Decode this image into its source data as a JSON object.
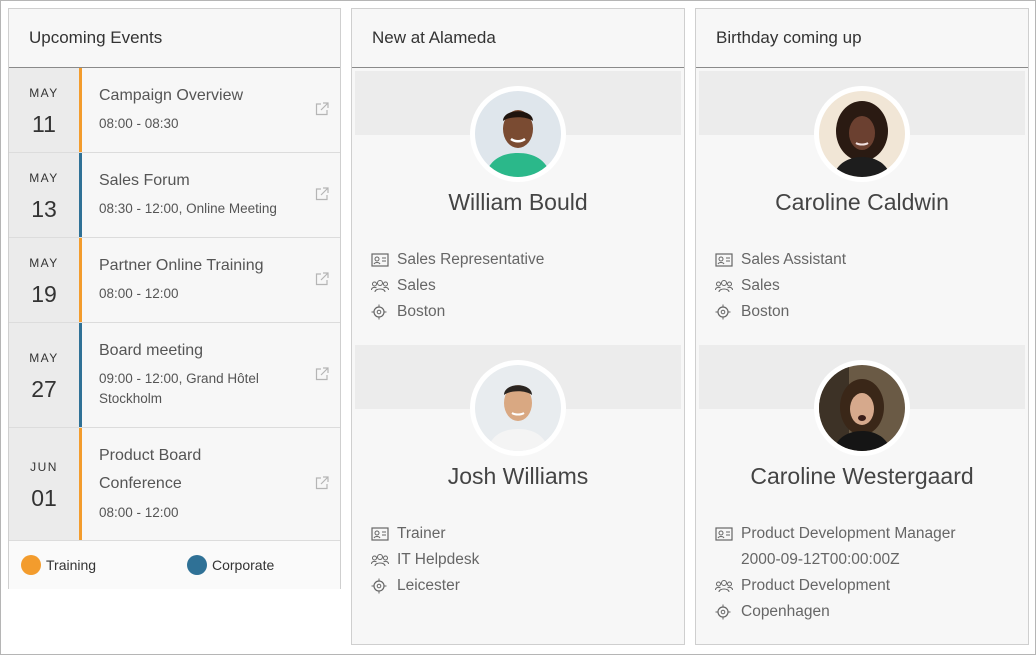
{
  "colors": {
    "training": "#f39c2d",
    "corporate": "#2f7196"
  },
  "events_card": {
    "title": "Upcoming Events",
    "events": [
      {
        "month": "MAY",
        "day": "11",
        "title": "Campaign Overview",
        "time": "08:00 - 08:30",
        "category": "training"
      },
      {
        "month": "MAY",
        "day": "13",
        "title": "Sales Forum",
        "time": "08:30 - 12:00, Online Meeting",
        "category": "corporate"
      },
      {
        "month": "MAY",
        "day": "19",
        "title": "Partner Online Training",
        "time": "08:00 - 12:00",
        "category": "training"
      },
      {
        "month": "MAY",
        "day": "27",
        "title": "Board meeting",
        "time": "09:00 - 12:00, Grand Hôtel Stockholm",
        "category": "corporate"
      },
      {
        "month": "JUN",
        "day": "01",
        "title": "Product Board Conference",
        "time": "08:00 - 12:00",
        "category": "training"
      }
    ],
    "legend": {
      "training": "Training",
      "corporate": "Corporate"
    }
  },
  "new_card": {
    "title": "New at Alameda",
    "people": [
      {
        "name": "William Bould",
        "role": "Sales Representative",
        "department": "Sales",
        "location": "Boston"
      },
      {
        "name": "Josh Williams",
        "role": "Trainer",
        "department": "IT Helpdesk",
        "location": "Leicester"
      }
    ]
  },
  "birthday_card": {
    "title": "Birthday coming up",
    "people": [
      {
        "name": "Caroline Caldwin",
        "role": "Sales Assistant",
        "department": "Sales",
        "location": "Boston"
      },
      {
        "name": "Caroline Westergaard",
        "role": "Product Development Manager",
        "birthday": "2000-09-12T00:00:00Z",
        "department": "Product Development",
        "location": "Copenhagen"
      }
    ]
  }
}
